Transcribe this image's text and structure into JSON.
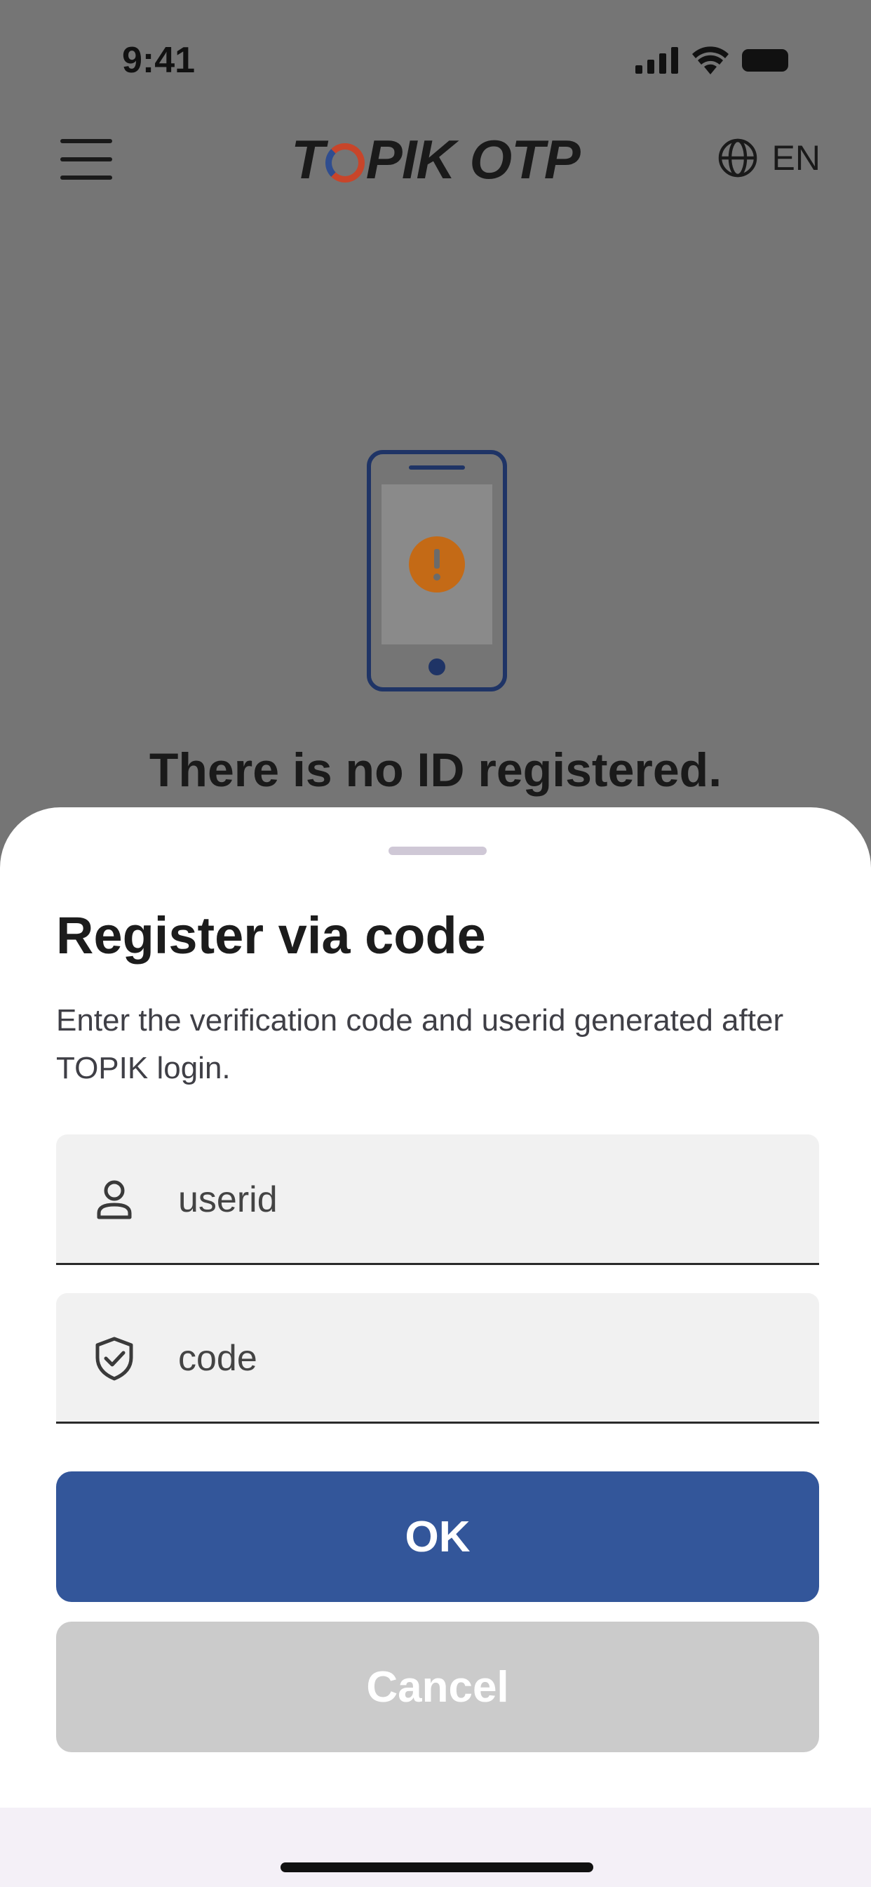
{
  "status_bar": {
    "time": "9:41",
    "icons": [
      "signal-icon",
      "wifi-icon",
      "battery-icon"
    ]
  },
  "header": {
    "menu_icon": "hamburger-menu-icon",
    "logo_prefix": "T",
    "logo_suffix": "PIK OTP",
    "language_icon": "globe-icon",
    "language_label": "EN"
  },
  "empty_state": {
    "icon": "phone-warning-icon",
    "title": "There is no ID registered."
  },
  "sheet": {
    "title": "Register via code",
    "description": "Enter the verification code and userid generated after TOPIK login.",
    "fields": {
      "userid": {
        "placeholder": "userid",
        "value": "",
        "icon": "person-icon"
      },
      "code": {
        "placeholder": "code",
        "value": "",
        "icon": "shield-check-icon"
      }
    },
    "ok_label": "OK",
    "cancel_label": "Cancel"
  },
  "colors": {
    "primary": "#33569a",
    "cancel": "#cbcbcb",
    "overlay": "#757575",
    "logo_red": "#c8452a",
    "logo_blue": "#2f4d8f",
    "warning": "#c46a16"
  }
}
